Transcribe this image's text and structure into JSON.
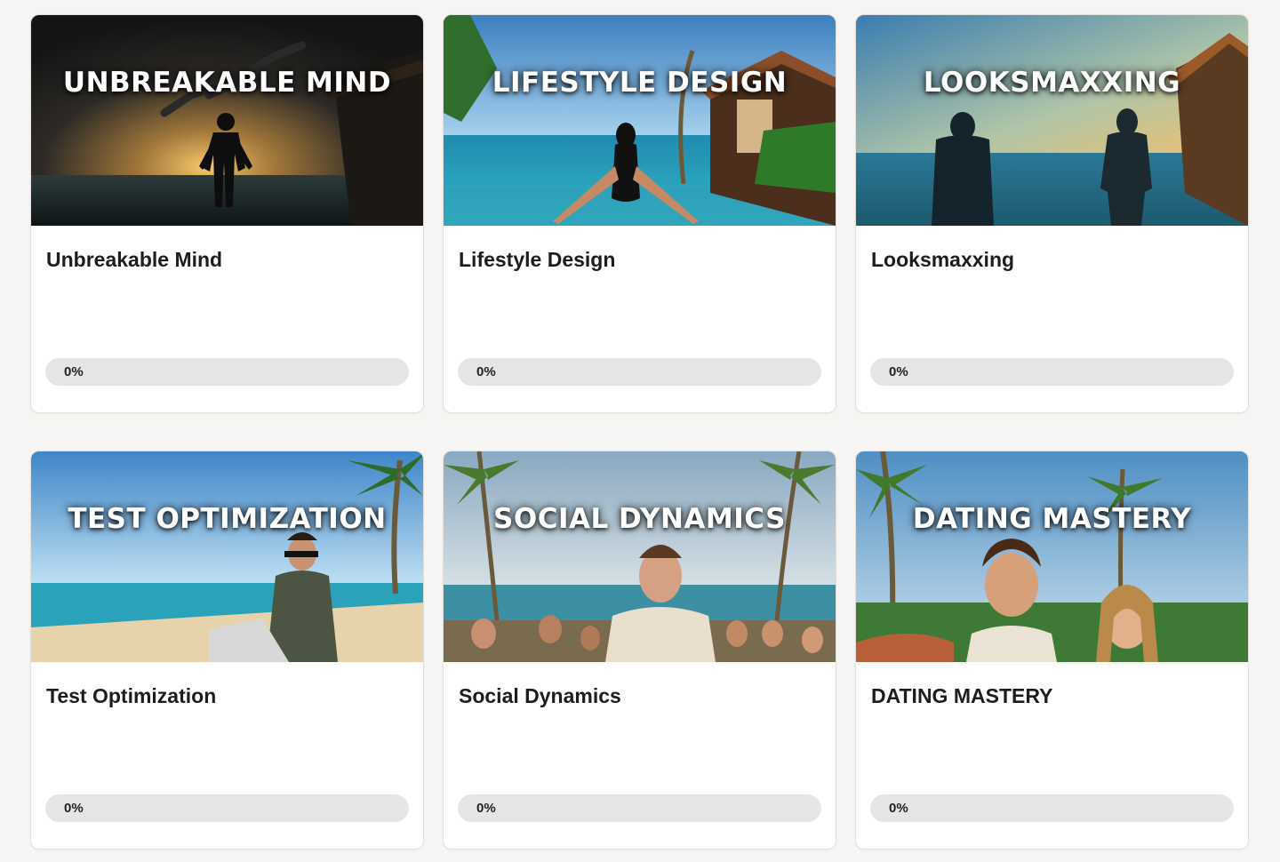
{
  "courses": [
    {
      "banner": "UNBREAKABLE MIND",
      "title": "Unbreakable Mind",
      "progress_label": "0%",
      "progress": 0,
      "image": "stormy-sunset-pool-silhouette-broken-chains"
    },
    {
      "banner": "LIFESTYLE DESIGN",
      "title": "Lifestyle Design",
      "progress_label": "0%",
      "progress": 0,
      "image": "woman-infinity-pool-tropical-villa"
    },
    {
      "banner": "LOOKSMAXXING",
      "title": "Looksmaxxing",
      "progress_label": "0%",
      "progress": 0,
      "image": "two-silhouettes-before-after-pool-sunset"
    },
    {
      "banner": "TEST OPTIMIZATION",
      "title": "Test Optimization",
      "progress_label": "0%",
      "progress": 0,
      "image": "man-laptop-tropical-beach"
    },
    {
      "banner": "SOCIAL DYNAMICS",
      "title": "Social Dynamics",
      "progress_label": "0%",
      "progress": 0,
      "image": "smiling-group-beach-palms"
    },
    {
      "banner": "DATING MASTERY",
      "title": "DATING MASTERY",
      "progress_label": "0%",
      "progress": 0,
      "image": "couple-smiling-palm-trees"
    }
  ]
}
